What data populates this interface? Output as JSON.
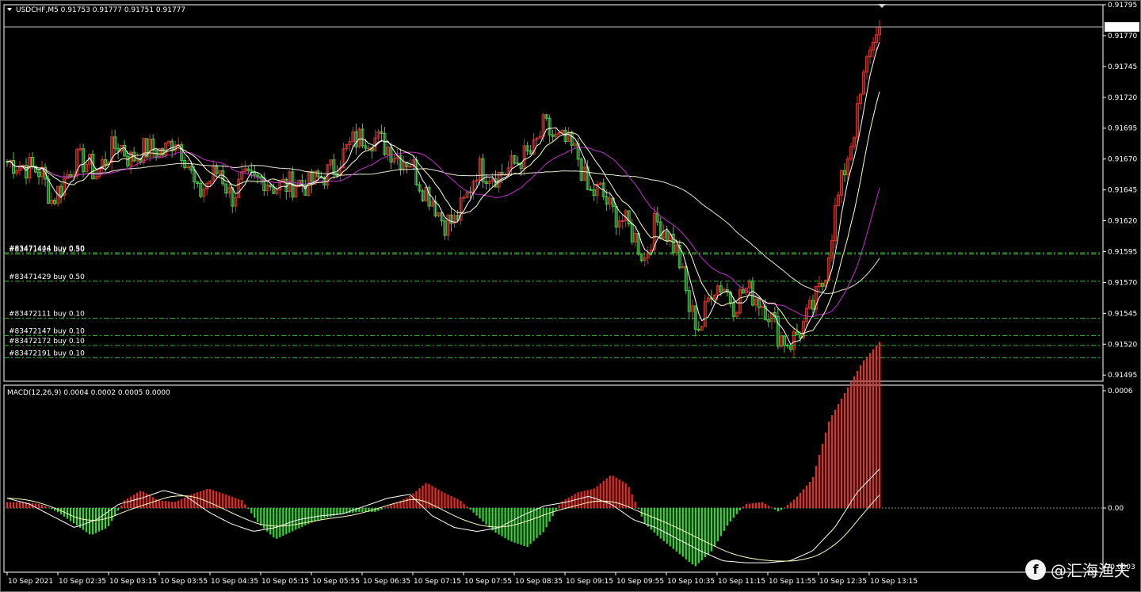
{
  "symbol_header": "USDCHF,M5  0.91753 0.91777 0.91751 0.91777",
  "macd_header": "MACD(12,26,9) 0.0004 0.0002 0.0005 0.0000",
  "current_price_label": "0.91777",
  "watermark": "@汇海渔夫",
  "colors": {
    "background": "#000000",
    "bull_candle": "#e0302a",
    "bear_candle": "#3fd13f",
    "ma_fast": "#ffffff",
    "ma_mid": "#ffffc0",
    "ma_slow": "#e8e8d0",
    "ma_magenta": "#c030c8",
    "order_line": "#2fbf2f",
    "hist_pos": "#e0302a",
    "hist_neg": "#3fd13f",
    "signal_line": "#ffffc0"
  },
  "chart_data": [
    {
      "type": "candlestick",
      "title": "USDCHF,M5",
      "ylim": [
        0.9149,
        0.91795
      ],
      "y_ticks": [
        "0.91795",
        "0.91770",
        "0.91745",
        "0.91720",
        "0.91695",
        "0.91670",
        "0.91645",
        "0.91620",
        "0.91595",
        "0.91570",
        "0.91545",
        "0.91520",
        "0.91495"
      ],
      "x_ticks": [
        "10 Sep 2021",
        "10 Sep 02:35",
        "10 Sep 03:15",
        "10 Sep 03:55",
        "10 Sep 04:35",
        "10 Sep 05:15",
        "10 Sep 05:55",
        "10 Sep 06:35",
        "10 Sep 07:15",
        "10 Sep 07:55",
        "10 Sep 08:35",
        "10 Sep 09:15",
        "10 Sep 09:55",
        "10 Sep 10:35",
        "10 Sep 11:15",
        "10 Sep 11:55",
        "10 Sep 12:35",
        "10 Sep 13:15"
      ],
      "close_path": [
        0.91668,
        0.91666,
        0.91663,
        0.9166,
        0.91636,
        0.91651,
        0.91668,
        0.91668,
        0.91657,
        0.91674,
        0.91683,
        0.91669,
        0.91677,
        0.91678,
        0.91675,
        0.91688,
        0.91671,
        0.9164,
        0.91652,
        0.91662,
        0.91638,
        0.91652,
        0.91651,
        0.91655,
        0.91647,
        0.91649,
        0.91651,
        0.91649,
        0.91655,
        0.91661,
        0.91673,
        0.91685,
        0.91689,
        0.91686,
        0.9168,
        0.91672,
        0.91669,
        0.91649,
        0.91638,
        0.91619,
        0.91619,
        0.91637,
        0.91663,
        0.91659,
        0.91657,
        0.91663,
        0.91671,
        0.91675,
        0.91697,
        0.91686,
        0.91683,
        0.91673,
        0.91641,
        0.91645,
        0.91628,
        0.91621,
        0.91609,
        0.91589,
        0.9162,
        0.91611,
        0.91592,
        0.91548,
        0.91532,
        0.91567,
        0.91568,
        0.91552,
        0.91565,
        0.91558,
        0.91548,
        0.91527,
        0.91521,
        0.91532,
        0.9155,
        0.91571,
        0.91626,
        0.91667,
        0.91705,
        0.91755,
        0.91777
      ],
      "orders": [
        {
          "label": "#83471444 buy 0.50",
          "price": 0.91594
        },
        {
          "label": "#83471426 buy 0.50",
          "price": 0.91593
        },
        {
          "label": "#83471429 buy 0.50",
          "price": 0.91571
        },
        {
          "label": "#83472111 buy 0.10",
          "price": 0.91541
        },
        {
          "label": "#83472147 buy 0.10",
          "price": 0.91527
        },
        {
          "label": "#83472172 buy 0.10",
          "price": 0.91519
        },
        {
          "label": "#83472191 buy 0.10",
          "price": 0.91509
        }
      ]
    },
    {
      "type": "histogram",
      "title": "MACD(12,26,9)",
      "ylim": [
        -0.0003,
        0.0006
      ],
      "y_ticks": [
        "0.0006",
        "0.00",
        "-0.0003"
      ],
      "histogram_path": [
        3e-05,
        3e-05,
        2e-05,
        -2e-05,
        -8e-05,
        -0.00014,
        -0.0001,
        4e-05,
        9e-05,
        4e-05,
        3e-05,
        7e-05,
        0.0001,
        7e-05,
        4e-05,
        -8e-05,
        -0.00016,
        -0.00012,
        -8e-05,
        -5e-05,
        -3e-05,
        -2e-05,
        -2e-05,
        2e-05,
        6e-05,
        0.00013,
        8e-05,
        4e-05,
        -4e-05,
        -0.00012,
        -0.00017,
        -0.0002,
        -0.00012,
        3e-05,
        8e-05,
        0.0001,
        0.00017,
        0.00012,
        -8e-05,
        -0.00016,
        -0.00023,
        -0.0003,
        -0.00022,
        -8e-05,
        2e-05,
        3e-05,
        -2e-05,
        5e-05,
        0.00015,
        0.00045,
        0.0006,
        0.00075,
        0.00085
      ],
      "signal_path": [
        5e-05,
        2e-05,
        -4e-05,
        -0.0001,
        -6e-05,
        2e-05,
        5e-05,
        9e-05,
        6e-05,
        -2e-05,
        -8e-05,
        -0.00012,
        -0.0001,
        -6e-05,
        -4e-05,
        -3e-05,
        1e-05,
        5e-05,
        7e-05,
        -4e-05,
        -0.0001,
        -0.00012,
        -0.0001,
        -4e-05,
        1e-05,
        3e-05,
        6e-05,
        2e-05,
        -6e-05,
        -0.0001,
        -0.00016,
        -0.00022,
        -0.00027,
        -0.00028,
        -0.00028,
        -0.00027,
        -0.00022,
        -0.0001,
        8e-05,
        0.0002
      ]
    }
  ]
}
